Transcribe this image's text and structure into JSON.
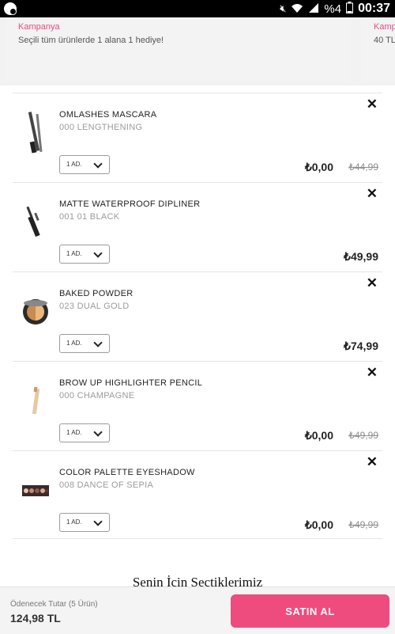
{
  "status_bar": {
    "battery_percent": "%4",
    "time": "00:37",
    "icons": [
      "app-notification-icon",
      "mute-icon",
      "wifi-icon",
      "signal-icon",
      "battery-icon"
    ]
  },
  "campaigns": [
    {
      "title": "Kampanya",
      "description": "Seçili tüm ürünlerde 1 alana 1 hediye!"
    },
    {
      "title": "Kampanya",
      "description": "40 TL"
    }
  ],
  "cart": {
    "items": [
      {
        "name": "OMLASHES MASCARA",
        "shade": "000 LENGTHENING",
        "qty": "1 AD.",
        "price": "₺0,00",
        "old_price": "₺44,99",
        "image": "mascara-image"
      },
      {
        "name": "MATTE WATERPROOF DIPLINER",
        "shade": "001 01 BLACK",
        "qty": "1 AD.",
        "price": "₺49,99",
        "old_price": "",
        "image": "eyeliner-image"
      },
      {
        "name": "BAKED POWDER",
        "shade": "023 DUAL GOLD",
        "qty": "1 AD.",
        "price": "₺74,99",
        "old_price": "",
        "image": "powder-compact-image"
      },
      {
        "name": "BROW UP HIGHLIGHTER PENCIL",
        "shade": "000 CHAMPAGNE",
        "qty": "1 AD.",
        "price": "₺0,00",
        "old_price": "₺49,99",
        "image": "pencil-image"
      },
      {
        "name": "COLOR PALETTE EYESHADOW",
        "shade": "008 DANCE OF SEPIA",
        "qty": "1 AD.",
        "price": "₺0,00",
        "old_price": "₺49,99",
        "image": "eyeshadow-palette-image"
      }
    ]
  },
  "section_title": "Senin İçin Seçtiklerimiz",
  "bottom_bar": {
    "total_label": "Ödenecek Tutar (5 Ürün)",
    "total_value": "124,98 TL",
    "buy_label": "SATIN AL"
  },
  "colors": {
    "accent": "#ee4b7e",
    "campaign_title": "#e84b7d"
  }
}
